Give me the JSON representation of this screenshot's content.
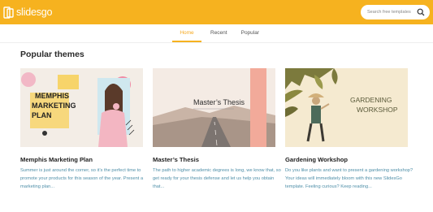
{
  "header": {
    "logo_text": "slidesgo",
    "search_placeholder": "Search free templates",
    "brand_color": "#f6b21f"
  },
  "tabs": [
    {
      "label": "Home",
      "active": true
    },
    {
      "label": "Recent",
      "active": false
    },
    {
      "label": "Popular",
      "active": false
    }
  ],
  "section": {
    "title": "Popular themes"
  },
  "cards": [
    {
      "title": "Memphis Marketing Plan",
      "thumb_text": "MEMPHIS MARKETING PLAN",
      "thumb_lines": [
        "MEMPHIS",
        "MARKETING",
        "PLAN"
      ],
      "description": "Summer is just around the corner, so it’s the perfect time to promote your products for this season of the year. Present a marketing plan..."
    },
    {
      "title": "Master’s Thesis",
      "thumb_text": "Master’s Thesis",
      "description": "The path to higher academic degrees is long, we know that, so get ready for your thesis defense and let us help you obtain that..."
    },
    {
      "title": "Gardening Workshop",
      "thumb_lines": [
        "GARDENING",
        "WORKSHOP"
      ],
      "description": "Do you like plants and want to present a gardening workshop? Your ideas will immediately bloom with this new SlidesGo template. Feeling curious? Keep reading..."
    }
  ]
}
